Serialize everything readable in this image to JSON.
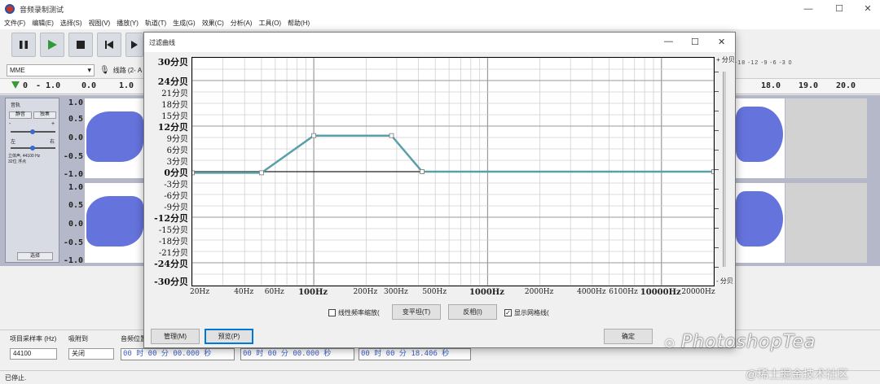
{
  "window": {
    "title": "音频录制测试"
  },
  "menu": [
    "文件(F)",
    "编辑(E)",
    "选择(S)",
    "视图(V)",
    "播放(Y)",
    "轨道(T)",
    "生成(G)",
    "效果(C)",
    "分析(A)",
    "工具(O)",
    "帮助(H)"
  ],
  "toolbar": {
    "meter_right": "-18 -12 -9 -6 -3 0"
  },
  "device": {
    "host": "MME",
    "input": "线路 (2- A"
  },
  "ruler": {
    "left_values": [
      "0",
      "- 1.0",
      "0.0",
      "1.0"
    ],
    "right_values": [
      "18.0",
      "19.0",
      "20.0"
    ]
  },
  "track": {
    "name": "音轨",
    "mute": "静音",
    "solo": "独奏",
    "gain_minus": "-",
    "gain_plus": "+",
    "pan_left": "左",
    "pan_right": "右",
    "info_rate": "立体声, 44100 Hz",
    "info_bits": "32位 浮点",
    "select": "选择",
    "scale": [
      "1.0",
      "0.5",
      "0.0",
      "-0.5",
      "-1.0"
    ]
  },
  "bottom": {
    "rate_label": "项目采样率 (Hz)",
    "snap_label": "吸附到",
    "pos_label": "音频位置",
    "rate_value": "44100",
    "snap_value": "关闭",
    "time1": "00 时 00 分 00.000 秒",
    "time2": "00 时 00 分 00.000 秒",
    "time3": "00 时 00 分 18.406 秒"
  },
  "status": "已停止.",
  "dialog": {
    "title": "过滤曲线",
    "db_labels": [
      {
        "db": 30,
        "text": "30分贝",
        "major": true
      },
      {
        "db": 24,
        "text": "24分贝",
        "major": true
      },
      {
        "db": 21,
        "text": "21分贝"
      },
      {
        "db": 18,
        "text": "18分贝"
      },
      {
        "db": 15,
        "text": "15分贝"
      },
      {
        "db": 12,
        "text": "12分贝",
        "major": true
      },
      {
        "db": 9,
        "text": "9分贝"
      },
      {
        "db": 6,
        "text": "6分贝"
      },
      {
        "db": 3,
        "text": "3分贝"
      },
      {
        "db": 0,
        "text": "0分贝",
        "major": true
      },
      {
        "db": -3,
        "text": "-3分贝"
      },
      {
        "db": -6,
        "text": "-6分贝"
      },
      {
        "db": -9,
        "text": "-9分贝"
      },
      {
        "db": -12,
        "text": "-12分贝",
        "major": true
      },
      {
        "db": -15,
        "text": "-15分贝"
      },
      {
        "db": -18,
        "text": "-18分贝"
      },
      {
        "db": -21,
        "text": "-21分贝"
      },
      {
        "db": -24,
        "text": "-24分贝",
        "major": true
      },
      {
        "db": -30,
        "text": "-30分贝",
        "major": true
      }
    ],
    "hz_labels": [
      {
        "hz": 20,
        "text": "20Hz"
      },
      {
        "hz": 40,
        "text": "40Hz"
      },
      {
        "hz": 60,
        "text": "60Hz"
      },
      {
        "hz": 100,
        "text": "100Hz",
        "major": true
      },
      {
        "hz": 200,
        "text": "200Hz"
      },
      {
        "hz": 300,
        "text": "300Hz"
      },
      {
        "hz": 500,
        "text": "500Hz"
      },
      {
        "hz": 1000,
        "text": "1000Hz",
        "major": true
      },
      {
        "hz": 2000,
        "text": "2000Hz"
      },
      {
        "hz": 4000,
        "text": "4000Hz"
      },
      {
        "hz": 6100,
        "text": "6100Hz"
      },
      {
        "hz": 10000,
        "text": "10000Hz",
        "major": true
      },
      {
        "hz": 20000,
        "text": "20000Hz"
      }
    ],
    "right_scale_top": "+ 分贝",
    "right_scale_bottom": "- 分贝",
    "linear_scale": "线性频率缩放(",
    "flatten": "变平坦(T)",
    "invert": "反相(I)",
    "show_grid": "显示网格线(",
    "manage": "管理(M)",
    "preview": "预览(P)",
    "ok": "确定"
  },
  "chart_data": {
    "type": "line",
    "x_scale": "log",
    "xlim": [
      20,
      20000
    ],
    "ylim": [
      -30,
      30
    ],
    "grid": true,
    "series": [
      {
        "points": [
          [
            20,
            -0.3
          ],
          [
            50,
            -0.3
          ],
          [
            100,
            9.5
          ],
          [
            280,
            9.5
          ],
          [
            420,
            0
          ],
          [
            20000,
            0
          ]
        ]
      }
    ],
    "line_color": "#5aa0a8"
  },
  "watermark": {
    "text": "PhotoshopTea",
    "site": "@稀土掘金技术社区"
  }
}
